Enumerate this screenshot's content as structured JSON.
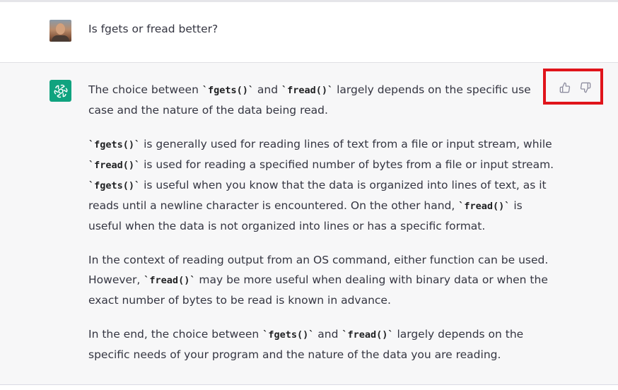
{
  "user_message": {
    "text": "Is fgets or fread better?"
  },
  "assistant_message": {
    "paragraphs": [
      [
        {
          "t": "The choice between "
        },
        {
          "t": "`fgets()`",
          "code": true
        },
        {
          "t": " and "
        },
        {
          "t": "`fread()`",
          "code": true
        },
        {
          "t": " largely depends on the specific use case and the nature of the data being read."
        }
      ],
      [
        {
          "t": "`fgets()`",
          "code": true
        },
        {
          "t": " is generally used for reading lines of text from a file or input stream, while "
        },
        {
          "t": "`fread()`",
          "code": true
        },
        {
          "t": " is used for reading a specified number of bytes from a file or input stream. "
        },
        {
          "t": "`fgets()`",
          "code": true
        },
        {
          "t": " is useful when you know that the data is organized into lines of text, as it reads until a newline character is encountered. On the other hand, "
        },
        {
          "t": "`fread()`",
          "code": true
        },
        {
          "t": " is useful when the data is not organized into lines or has a specific format."
        }
      ],
      [
        {
          "t": "In the context of reading output from an OS command, either function can be used. However, "
        },
        {
          "t": "`fread()`",
          "code": true
        },
        {
          "t": " may be more useful when dealing with binary data or when the exact number of bytes to be read is known in advance."
        }
      ],
      [
        {
          "t": "In the end, the choice between "
        },
        {
          "t": "`fgets()`",
          "code": true
        },
        {
          "t": " and "
        },
        {
          "t": "`fread()`",
          "code": true
        },
        {
          "t": " largely depends on the specific needs of your program and the nature of the data you are reading."
        }
      ]
    ]
  },
  "feedback": {
    "thumbs_up_icon": "thumbs-up-icon",
    "thumbs_down_icon": "thumbs-down-icon",
    "highlight_color": "#e0141b"
  },
  "colors": {
    "assistant_bg": "#f7f7f8",
    "bot_avatar": "#10a37f",
    "text": "#343541"
  }
}
